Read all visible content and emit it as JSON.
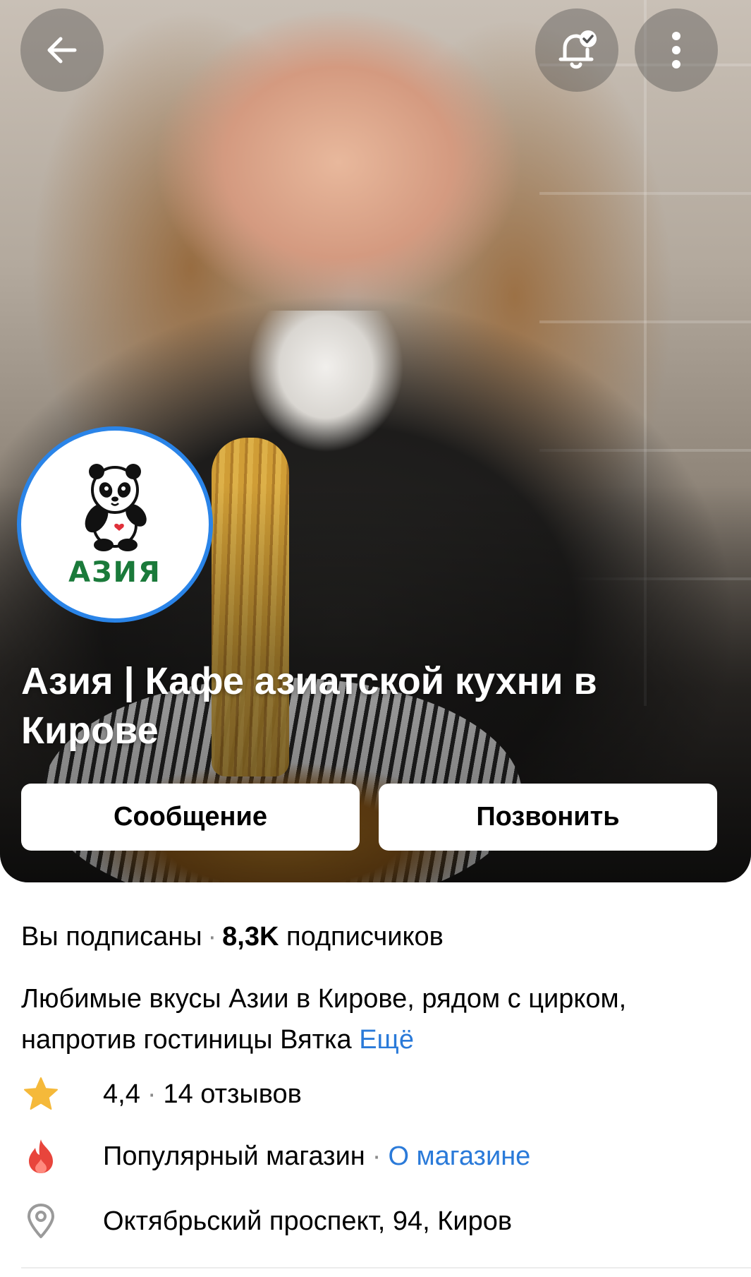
{
  "shop": {
    "title": "Азия | Кафе азиатской кухни в Кирове",
    "logo_text": "АЗИЯ"
  },
  "actions": {
    "message_label": "Сообщение",
    "call_label": "Позвонить"
  },
  "subscription": {
    "status": "Вы подписаны",
    "separator": "·",
    "count": "8,3K",
    "count_label": "подписчиков"
  },
  "description": {
    "text": "Любимые вкусы Азии в Кирове, рядом с цирком, напротив гостиницы Вятка",
    "more_label": "Ещё"
  },
  "rating": {
    "value": "4,4",
    "separator": "·",
    "reviews": "14 отзывов",
    "icon": "star-icon"
  },
  "popular": {
    "label": "Популярный магазин",
    "separator": "·",
    "link": "О магазине",
    "icon": "fire-icon"
  },
  "address": {
    "text": "Октябрьский проспект, 94, Киров",
    "icon": "location-pin-icon"
  },
  "header": {
    "back_icon": "back-arrow-icon",
    "bell_icon": "bell-check-icon",
    "more_icon": "more-vertical-icon"
  },
  "colors": {
    "accent_blue": "#2a7ad9",
    "logo_ring": "#2a84e8",
    "logo_green": "#1a7a3a",
    "star": "#f5b93a",
    "fire": "#e8453c",
    "pin": "#9a9a9a"
  }
}
